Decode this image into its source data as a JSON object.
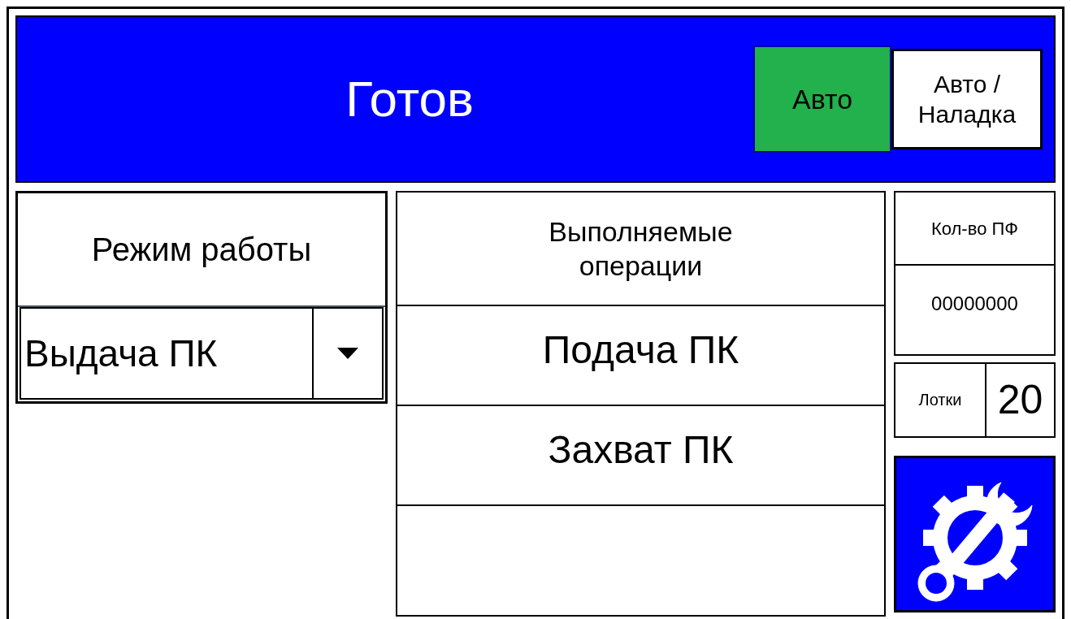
{
  "header": {
    "status": "Готов",
    "mode_buttons": [
      {
        "label": "Авто",
        "selected": true
      },
      {
        "label": "Авто / Наладка",
        "selected": false
      }
    ]
  },
  "mode_panel": {
    "title": "Режим работы",
    "value": "Выдача ПК"
  },
  "operations": {
    "title": "Выполняемые операции",
    "items": [
      "Подача ПК",
      "Захват ПК"
    ]
  },
  "counter": {
    "label": "Кол-во ПФ",
    "value": "00000000"
  },
  "trays": {
    "label": "Лотки",
    "value": "20"
  }
}
